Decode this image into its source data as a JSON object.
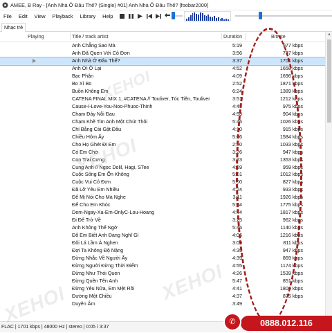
{
  "window": {
    "title": "AMEE, B Ray - [Anh Nhà Ở Đâu Thế? (Single) #01] Anh Nhà Ở Đâu Thế? [foobar2000]"
  },
  "menu": [
    "File",
    "Edit",
    "View",
    "Playback",
    "Library",
    "Help"
  ],
  "playlist_tab": "Nhạc trẻ",
  "columns": {
    "playing": "Playing",
    "title": "Title / track artist",
    "duration": "Duration",
    "bitrate": "Bitrate"
  },
  "seek_progress": 0.02,
  "volume_level": 0.6,
  "rows": [
    {
      "title": "Anh Chẳng Sao Mà",
      "duration": "5:19",
      "bitrate": "977 kbps"
    },
    {
      "title": "Anh Đã Quen Với Cô Đơn",
      "duration": "3:56",
      "bitrate": "737 kbps"
    },
    {
      "title": "Anh Nhà Ở Đâu Thế?",
      "duration": "3:37",
      "bitrate": "1701 kbps",
      "playing": true
    },
    {
      "title": "Anh Ơi Ở Lại",
      "duration": "4:52",
      "bitrate": "1658 kbps"
    },
    {
      "title": "Bạc Phận",
      "duration": "4:09",
      "bitrate": "1696 kbps"
    },
    {
      "title": "Bo Xì Bo",
      "duration": "2:52",
      "bitrate": "1871 kbps"
    },
    {
      "title": "Buồn Không Em",
      "duration": "6:24",
      "bitrate": "1389 kbps"
    },
    {
      "title": "CATENA FINAL MIX 1, #CATENA // Touliver, Tóc Tiên, Touliver",
      "duration": "3:51",
      "bitrate": "1212 kbps"
    },
    {
      "title": "Cause-I-Love-You-Noo-Phuoc-Thinh",
      "duration": "4:45",
      "bitrate": "975 kbps"
    },
    {
      "title": "Chạm Đáy Nỗi Đau",
      "duration": "4:53",
      "bitrate": "904 kbps"
    },
    {
      "title": "Chạm Khẽ Tim Anh Một Chút Thôi",
      "duration": "5:46",
      "bitrate": "1026 kbps"
    },
    {
      "title": "Chỉ Bằng Cái Gật Đầu",
      "duration": "4:10",
      "bitrate": "915 kbps"
    },
    {
      "title": "Chiều Hôm Ấy",
      "duration": "5:06",
      "bitrate": "1584 kbps"
    },
    {
      "title": "Cho Họ Ghét Đi Em",
      "duration": "2:50",
      "bitrate": "1033 kbps"
    },
    {
      "title": "Có Em Chờ",
      "duration": "3:26",
      "bitrate": "947 kbps"
    },
    {
      "title": "Con Trai Cưng",
      "duration": "3:23",
      "bitrate": "1353 kbps"
    },
    {
      "title": "Cung Anh // Ngọc Dolil, Hagi, STee",
      "duration": "4:59",
      "bitrate": "959 kbps"
    },
    {
      "title": "Cuộc Sống Em Ổn Không",
      "duration": "5:01",
      "bitrate": "1012 kbps"
    },
    {
      "title": "Cuộc Vui Cô Đơn",
      "duration": "5:00",
      "bitrate": "827 kbps"
    },
    {
      "title": "Đã Lỡ Yêu Em Nhiều",
      "duration": "4:24",
      "bitrate": "933 kbps"
    },
    {
      "title": "Để Mị Nói Cho Mà Nghe",
      "duration": "3:11",
      "bitrate": "1926 kbps"
    },
    {
      "title": "Để Cho Em Khóc",
      "duration": "5:04",
      "bitrate": "1775 kbps"
    },
    {
      "title": "Dem-Ngay-Xa-Em-OnlyC-Lou-Hoang",
      "duration": "4:44",
      "bitrate": "1817 kbps"
    },
    {
      "title": "Đi Để Trở Về",
      "duration": "3:25",
      "bitrate": "962 kbps"
    },
    {
      "title": "Anh Không Thể Ngờ",
      "duration": "5:46",
      "bitrate": "1140 kbps"
    },
    {
      "title": "Đổ Em Biết Anh Đang Nghĩ Gì",
      "duration": "4:06",
      "bitrate": "1216 kbps"
    },
    {
      "title": "Đôi Lá Lầm Á Nghen",
      "duration": "3:09",
      "bitrate": "811 kbps"
    },
    {
      "title": "Đợi Ta Không Độ Nặng",
      "duration": "4:35",
      "bitrate": "947 kbps"
    },
    {
      "title": "Đừng Nhắc Về Người Ấy",
      "duration": "4:39",
      "bitrate": "869 kbps"
    },
    {
      "title": "Đừng Người Đừng Thời Điểm",
      "duration": "4:55",
      "bitrate": "1174 kbps"
    },
    {
      "title": "Đừng Như Thói Quen",
      "duration": "4:26",
      "bitrate": "1539 kbps"
    },
    {
      "title": "Đừng Quên Tên Anh",
      "duration": "5:47",
      "bitrate": "851 kbps"
    },
    {
      "title": "Đừng Yêu Nữa, Em Mệt Rồi",
      "duration": "4:41",
      "bitrate": "1800 kbps"
    },
    {
      "title": "Đường Một Chiều",
      "duration": "4:37",
      "bitrate": "875 kbps"
    },
    {
      "title": "Duyên Âm",
      "duration": "3:49",
      "bitrate": ""
    }
  ],
  "status": "FLAC | 1701 kbps | 48000 Hz | stereo | 0:05 / 3:37",
  "watermark": "XEHOI",
  "phone": "0888.012.116",
  "colors": {
    "selection": "#cde5fb",
    "accent": "#1c6fd8",
    "annotation": "#a0201c",
    "badge": "#c4161c"
  }
}
